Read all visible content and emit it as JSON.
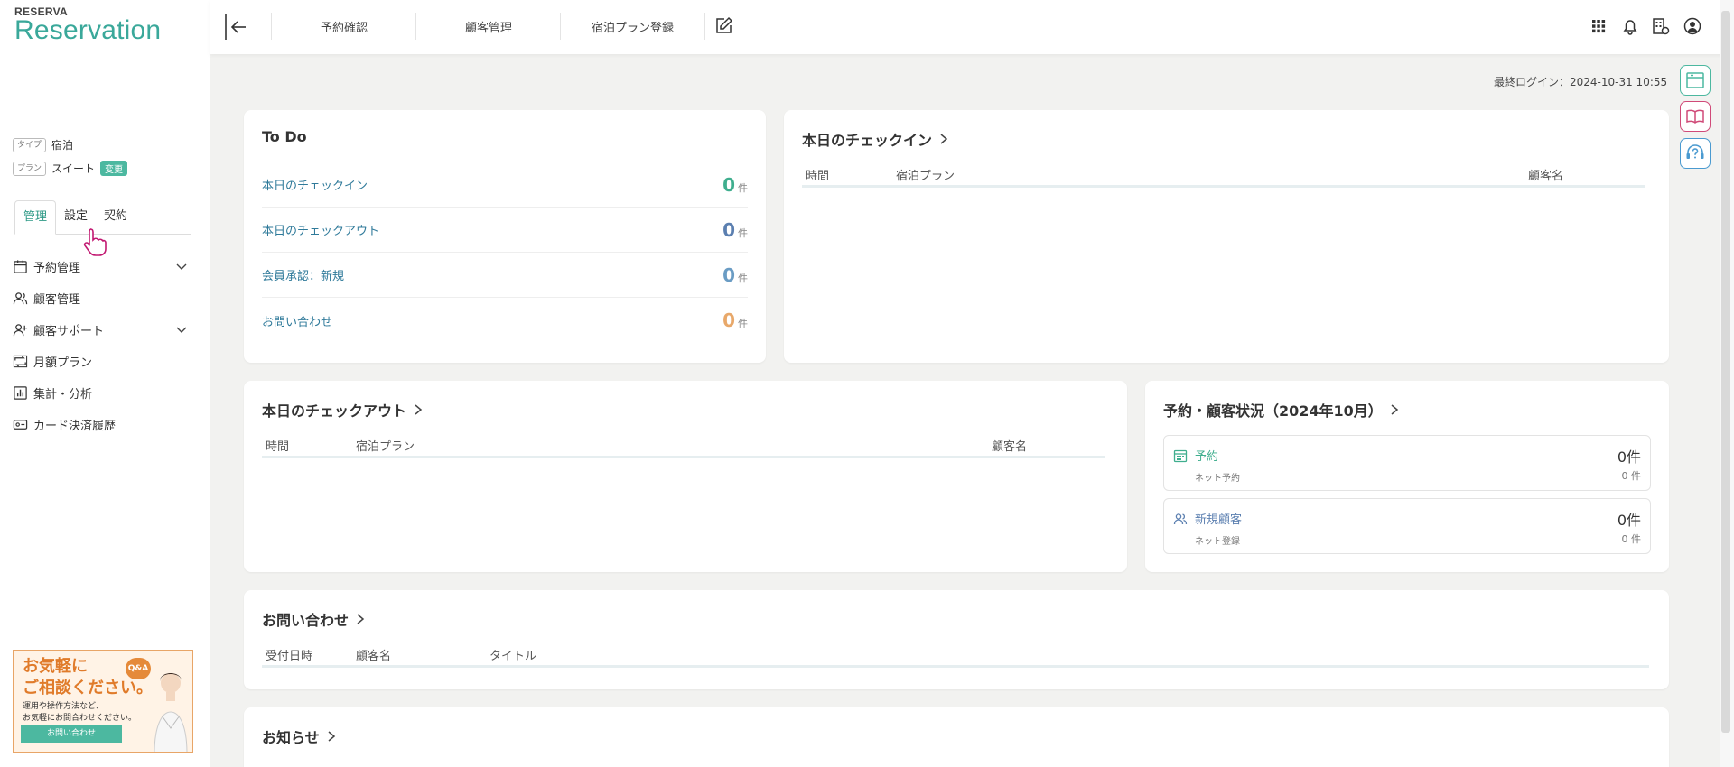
{
  "logo": {
    "small": "RESERVA",
    "big": "Reservation"
  },
  "meta": {
    "type_tag": "タイプ",
    "type_value": "宿泊",
    "plan_tag": "プラン",
    "plan_value": "スイート",
    "change_label": "変更"
  },
  "tabs": [
    {
      "label": "管理"
    },
    {
      "label": "設定"
    },
    {
      "label": "契約"
    }
  ],
  "nav": [
    {
      "label": "予約管理",
      "icon": "calendar-icon",
      "expandable": true
    },
    {
      "label": "顧客管理",
      "icon": "users-icon",
      "expandable": false
    },
    {
      "label": "顧客サポート",
      "icon": "user-plus-icon",
      "expandable": true
    },
    {
      "label": "月額プラン",
      "icon": "repeat-icon",
      "expandable": false
    },
    {
      "label": "集計・分析",
      "icon": "bar-chart-icon",
      "expandable": false
    },
    {
      "label": "カード決済履歴",
      "icon": "card-icon",
      "expandable": false
    }
  ],
  "banner": {
    "title_line1": "お気軽に",
    "title_line2": "ご相談ください。",
    "qa": "Q&A",
    "text_line1": "運用や操作方法など、",
    "text_line2": "お気軽にお問合わせください。",
    "button": "お問い合わせ"
  },
  "topbar": {
    "links": [
      "予約確認",
      "顧客管理",
      "宿泊プラン登録"
    ],
    "icons": [
      "grid-icon",
      "bell-icon",
      "building-settings-icon",
      "account-icon"
    ]
  },
  "last_login": "最終ログイン：2024-10-31 10:55",
  "todo": {
    "title": "To Do",
    "unit": "件",
    "rows": [
      {
        "label": "本日のチェックイン",
        "count": "0",
        "color": "#3fae8e"
      },
      {
        "label": "本日のチェックアウト",
        "count": "0",
        "color": "#5b7fb0"
      },
      {
        "label": "会員承認：新規",
        "count": "0",
        "color": "#6a9cc4"
      },
      {
        "label": "お問い合わせ",
        "count": "0",
        "color": "#e8a86a"
      }
    ]
  },
  "checkin": {
    "title": "本日のチェックイン",
    "columns": [
      "時間",
      "宿泊プラン",
      "顧客名"
    ]
  },
  "checkout": {
    "title": "本日のチェックアウト",
    "columns": [
      "時間",
      "宿泊プラン",
      "顧客名"
    ]
  },
  "status": {
    "title": "予約・顧客状況（2024年10月）",
    "items": [
      {
        "label": "予約",
        "sub": "ネット予約",
        "count": "0件",
        "sub_count": "0 件",
        "color": "#3fae8e"
      },
      {
        "label": "新規顧客",
        "sub": "ネット登録",
        "count": "0件",
        "sub_count": "0 件",
        "color": "#5b7fb0"
      }
    ]
  },
  "inquiry": {
    "title": "お問い合わせ",
    "columns": [
      "受付日時",
      "顧客名",
      "タイトル"
    ]
  },
  "news": {
    "title": "お知らせ"
  },
  "colors": {
    "accent": "#3aa89a",
    "link": "#2f7a9a"
  }
}
